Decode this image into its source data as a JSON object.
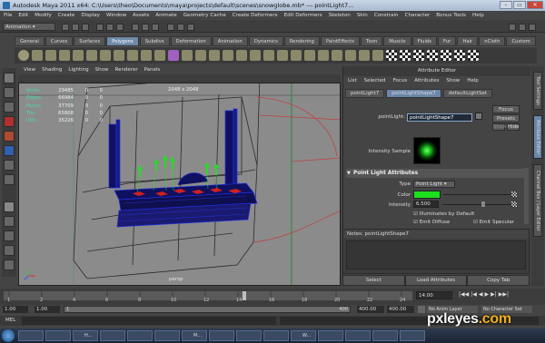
{
  "title_bar": {
    "title": "Autodesk Maya 2011 x64: C:\\Users\\theo\\Documents\\maya\\projects\\default\\scenes\\snowglobe.mb* --- pointLight7..."
  },
  "menu": [
    "File",
    "Edit",
    "Modify",
    "Create",
    "Display",
    "Window",
    "Assets",
    "Animate",
    "Geometry Cache",
    "Create Deformers",
    "Edit Deformers",
    "Skeleton",
    "Skin",
    "Constrain",
    "Character",
    "Bonus Tools",
    "Help"
  ],
  "mode_selector": {
    "value": "Animation"
  },
  "shelf_tabs": [
    "General",
    "Curves",
    "Surfaces",
    "Polygons",
    "Subdivs",
    "Deformation",
    "Animation",
    "Dynamics",
    "Rendering",
    "PaintEffects",
    "Toon",
    "Muscle",
    "Fluids",
    "Fur",
    "Hair",
    "nCloth",
    "Custom"
  ],
  "shelf_active_tab": "Polygons",
  "viewport": {
    "menu": [
      "View",
      "Shading",
      "Lighting",
      "Show",
      "Renderer",
      "Panels"
    ],
    "hud": [
      {
        "label": "Verts:",
        "value": "29485",
        "a": "0",
        "b": "0"
      },
      {
        "label": "Edges:",
        "value": "66984",
        "a": "0",
        "b": "0"
      },
      {
        "label": "Faces:",
        "value": "37709",
        "a": "0",
        "b": "0"
      },
      {
        "label": "Tris:",
        "value": "65808",
        "a": "0",
        "b": "0"
      },
      {
        "label": "UVs:",
        "value": "35226",
        "a": "0",
        "b": "0"
      }
    ],
    "resolution": "2048 x 2048",
    "camera_label": "persp"
  },
  "attribute_editor": {
    "header": "Attribute Editor",
    "menu": [
      "List",
      "Selected",
      "Focus",
      "Attributes",
      "Show",
      "Help"
    ],
    "tabs": [
      "pointLight7",
      "pointLightShape7",
      "defaultLightSet"
    ],
    "active_tab": "pointLightShape7",
    "node_label": "pointLight:",
    "node_value": "pointLightShape7",
    "focus_label": "Focus",
    "presets_label": "Presets",
    "show_label": "Show",
    "hide_label": "Hide",
    "sample_label": "Intensity Sample",
    "section_title": "Point Light Attributes",
    "type_label": "Type",
    "type_value": "Point Light",
    "color_label": "Color",
    "color_hex": "#1be01b",
    "intensity_label": "Intensity",
    "intensity_value": "6.500",
    "illuminates_label": "Illuminates by Default",
    "emit_diffuse_label": "Emit Diffuse",
    "emit_specular_label": "Emit Specular",
    "notes_label": "Notes:  pointLightShape7",
    "buttons": [
      "Select",
      "Load Attributes",
      "Copy Tab"
    ]
  },
  "side_tabs": [
    "Tool Settings",
    "Attribute Editor",
    "Channel Box / Layer Editor"
  ],
  "timeline": {
    "ticks": [
      "1",
      "2",
      "4",
      "6",
      "8",
      "10",
      "12",
      "14",
      "16",
      "18",
      "20",
      "22",
      "24"
    ],
    "current_frame": "14.00",
    "range_start": "1.00",
    "range_start2": "1.00",
    "range_mid": "1",
    "range_end_marker": "400",
    "range_end": "400.00",
    "range_end2": "400.00",
    "anim_layer": "No Anim Layer",
    "character_set": "No Character Set"
  },
  "command_line": {
    "label": "MEL"
  },
  "watermark": {
    "text": "pxleyes",
    "suffix": ".com"
  },
  "taskbar": [
    "",
    "",
    "",
    "H...",
    "",
    "",
    "",
    "",
    "",
    "M...",
    "",
    "",
    "",
    "",
    "W...",
    "",
    "",
    "",
    "",
    ""
  ]
}
